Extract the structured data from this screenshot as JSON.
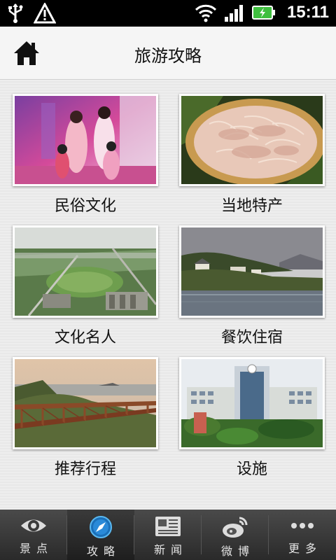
{
  "statusbar": {
    "time": "15:11"
  },
  "header": {
    "title": "旅游攻略"
  },
  "tiles": [
    {
      "label": "民俗文化"
    },
    {
      "label": "当地特产"
    },
    {
      "label": "文化名人"
    },
    {
      "label": "餐饮住宿"
    },
    {
      "label": "推荐行程"
    },
    {
      "label": "设施"
    }
  ],
  "nav": [
    {
      "label": "景点",
      "icon": "eye-icon"
    },
    {
      "label": "攻略",
      "icon": "compass-icon"
    },
    {
      "label": "新闻",
      "icon": "newspaper-icon"
    },
    {
      "label": "微博",
      "icon": "weibo-icon"
    },
    {
      "label": "更多",
      "icon": "more-icon"
    }
  ],
  "colors": {
    "active_icon": "#3aa0e8",
    "nav_bg": "#3a3a3a"
  }
}
